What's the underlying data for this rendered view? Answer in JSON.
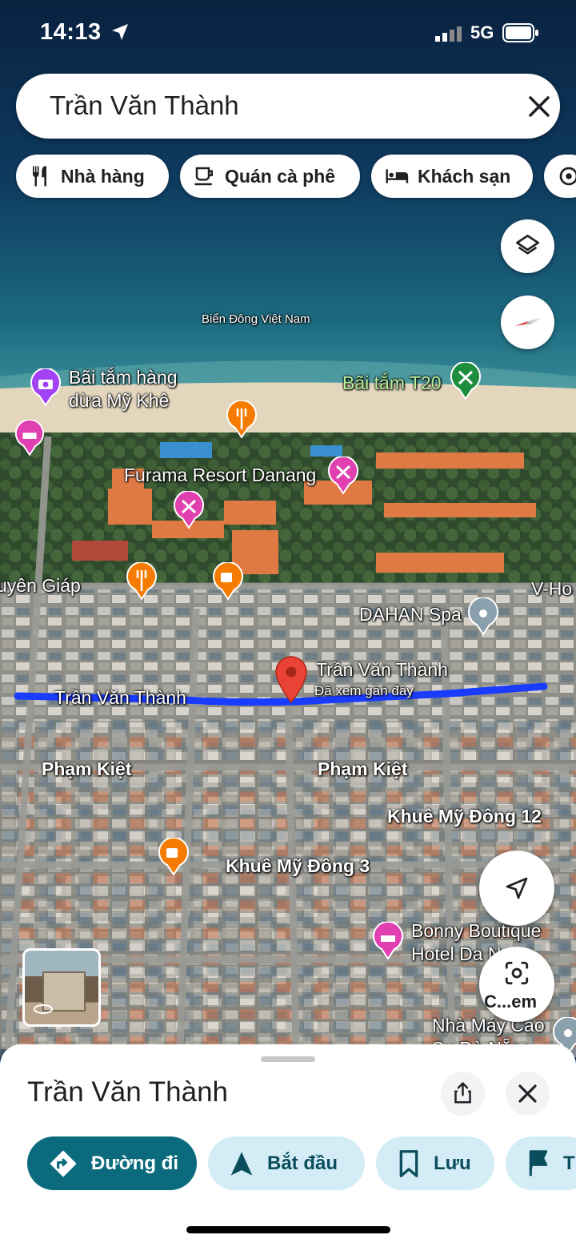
{
  "status_bar": {
    "time": "14:13",
    "network": "5G"
  },
  "search": {
    "query": "Trần Văn Thành"
  },
  "chips": [
    {
      "label": "Nhà hàng",
      "icon": "fork-knife-icon"
    },
    {
      "label": "Quán cà phê",
      "icon": "coffee-cup-icon"
    },
    {
      "label": "Khách sạn",
      "icon": "bed-icon"
    }
  ],
  "map": {
    "sea_label": "Biển Đông Việt Nam",
    "places": {
      "beach_palm": "Bãi tắm hàng\ndừa Mỹ Khê",
      "beach_t20": "Bãi tắm T20",
      "furama": "Furama Resort Danang",
      "dahan": "DAHAN Spa",
      "selected_street": "Trần Văn Thành",
      "selected_sub": "Đã xem gần đây",
      "bonny": "Bonny Boutique\nHotel Da N...",
      "factory": "Nhà Máy Cao\nSu Đà Nẵng"
    },
    "roads": {
      "vo_nguyen_giap": "uyên Giáp",
      "v_ho": "V-Ho",
      "tran_van_thanh": "Trần Văn Thành",
      "pham_kiet_left": "Phạm Kiệt",
      "pham_kiet_right": "Phạm Kiệt",
      "khue_my_dong_12": "Khuê Mỹ Đông 12",
      "khue_my_dong_3": "Khuê Mỹ Đông 3"
    },
    "camera_label": "C...em",
    "colors": {
      "route": "#1a3cff",
      "pin": "#ea4335",
      "hotel": "#e040b0",
      "food": "#f57c00",
      "teal": "#188038"
    }
  },
  "sheet": {
    "title": "Trần Văn Thành",
    "actions": [
      {
        "label": "Đường đi",
        "icon": "directions-icon"
      },
      {
        "label": "Bắt đầu",
        "icon": "navigation-arrow-icon"
      },
      {
        "label": "Lưu",
        "icon": "bookmark-icon"
      },
      {
        "label": "T",
        "icon": "flag-icon"
      }
    ]
  }
}
